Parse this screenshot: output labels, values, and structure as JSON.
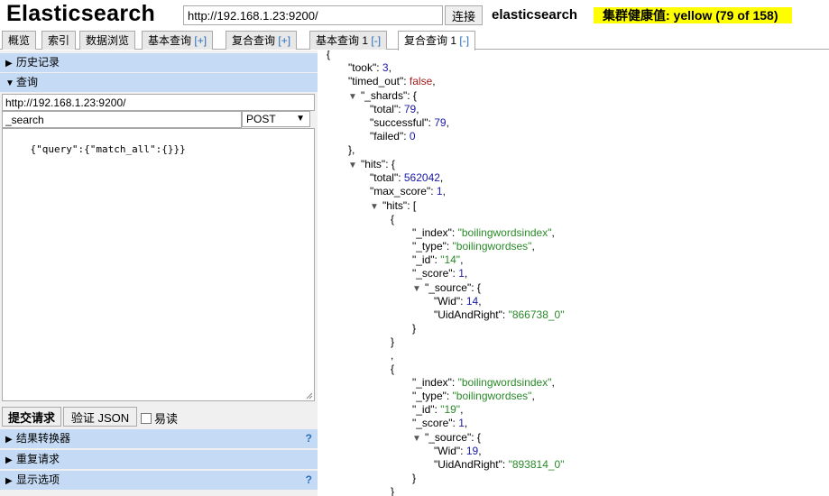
{
  "header": {
    "app_title": "Elasticsearch",
    "url_value": "http://192.168.1.23:9200/",
    "connect_label": "连接",
    "cluster_name": "elasticsearch",
    "health_text": "集群健康值: yellow (79 of 158)",
    "health_color": "#ffff00"
  },
  "tabs": [
    {
      "label": "概览"
    },
    {
      "label": "索引"
    },
    {
      "label": "数据浏览"
    },
    {
      "label": "基本查询",
      "ctl": "[+]"
    },
    {
      "label": "复合查询",
      "ctl": "[+]"
    },
    {
      "label": "基本查询 1",
      "ctl": "[-]"
    },
    {
      "label": "复合查询 1",
      "ctl": "[-]",
      "active": true
    }
  ],
  "left": {
    "history_label": "历史记录",
    "query_label": "查询",
    "host_value": "http://192.168.1.23:9200/",
    "path_value": "_search",
    "method_value": "POST",
    "body_value": "{\"query\":{\"match_all\":{}}}",
    "submit_label": "提交请求",
    "validate_label": "验证 JSON",
    "readonly_label": "易读",
    "result_transformer_label": "结果转换器",
    "repeat_request_label": "重复请求",
    "display_options_label": "显示选项",
    "help_glyph": "?"
  },
  "response": {
    "open_brace": "{",
    "took_key": "\"took\": ",
    "took_val": "3",
    "timed_out_key": "\"timed_out\": ",
    "timed_out_val": "false",
    "shards_key": "\"_shards\": {",
    "total_key": "\"total\": ",
    "total_val": "79",
    "successful_key": "\"successful\": ",
    "successful_val": "79",
    "failed_key": "\"failed\": ",
    "failed_val": "0",
    "close_shards": "},",
    "hits_key": "\"hits\": {",
    "hits_total_key": "\"total\": ",
    "hits_total_val": "562042",
    "max_score_key": "\"max_score\": ",
    "max_score_val": "1",
    "hits_arr_key": "\"hits\": [",
    "index_key": "\"_index\": ",
    "index_val": "\"boilingwordsindex\"",
    "type_key": "\"_type\": ",
    "type_val": "\"boilingwordses\"",
    "id_key": "\"_id\": ",
    "score_key": "\"_score\": ",
    "score_val": "1",
    "source_key": "\"_source\": {",
    "wid_key": "\"Wid\": ",
    "uid_key": "\"UidAndRight\": ",
    "doc1": {
      "id": "\"14\"",
      "wid": "14",
      "uid": "\"866738_0\""
    },
    "doc2": {
      "id": "\"19\"",
      "wid": "19",
      "uid": "\"893814_0\""
    },
    "lbrace": "{",
    "rbrace": "}",
    "comma": ",",
    "tri_glyph": "▼"
  }
}
